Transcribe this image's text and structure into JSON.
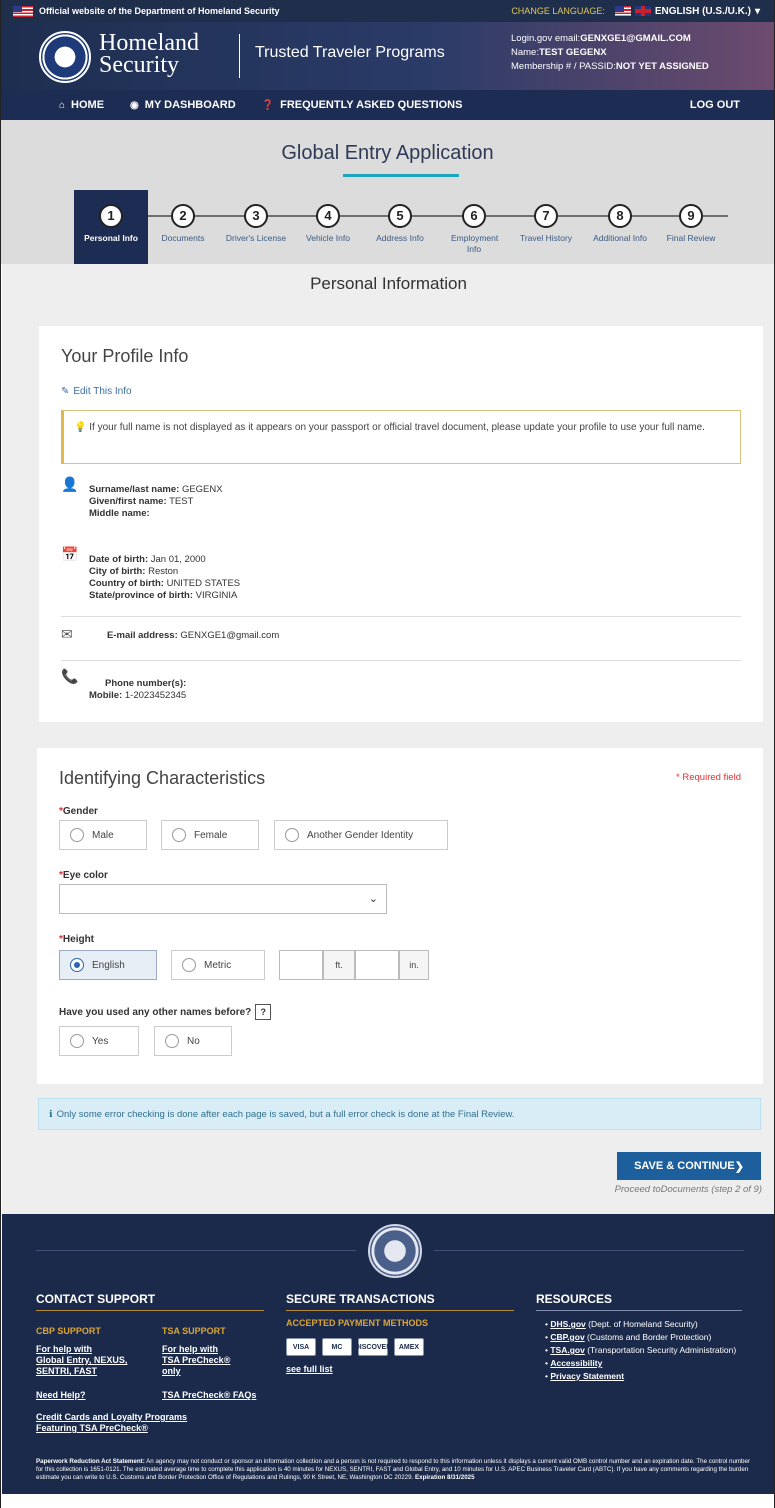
{
  "topbar": {
    "official_text": "Official website of the Department of Homeland Security",
    "change_language_label": "CHANGE LANGUAGE:",
    "language_value": "ENGLISH (U.S./U.K.)"
  },
  "header": {
    "brand_line1": "Homeland",
    "brand_line2": "Security",
    "program_title": "Trusted Traveler Programs",
    "login_label": "Login.gov email:",
    "login_email": "GENXGE1@GMAIL.COM",
    "name_label": "Name:",
    "name_value": "TEST GEGENX",
    "membership_label": "Membership # / PASSID:",
    "membership_value": "NOT YET ASSIGNED"
  },
  "nav": {
    "home": "HOME",
    "dashboard": "MY DASHBOARD",
    "faq": "FREQUENTLY ASKED QUESTIONS",
    "logout": "LOG OUT"
  },
  "page_title": "Global Entry Application",
  "steps": [
    {
      "num": "1",
      "label": "Personal Info",
      "active": true
    },
    {
      "num": "2",
      "label": "Documents"
    },
    {
      "num": "3",
      "label": "Driver's License"
    },
    {
      "num": "4",
      "label": "Vehicle Info"
    },
    {
      "num": "5",
      "label": "Address Info"
    },
    {
      "num": "6",
      "label": "Employment Info"
    },
    {
      "num": "7",
      "label": "Travel History"
    },
    {
      "num": "8",
      "label": "Additional Info"
    },
    {
      "num": "9",
      "label": "Final Review"
    }
  ],
  "section_title": "Personal Information",
  "profile": {
    "heading": "Your Profile Info",
    "edit_link": "Edit This Info",
    "notice": "If your full name is not displayed as it appears on your passport or official travel document, please update your profile to use your full name.",
    "surname_label": "Surname/last name:",
    "surname_value": "GEGENX",
    "given_label": "Given/first name:",
    "given_value": "TEST",
    "middle_label": "Middle name:",
    "middle_value": "",
    "dob_label": "Date of birth:",
    "dob_value": "Jan 01, 2000",
    "city_label": "City of birth:",
    "city_value": "Reston",
    "country_label": "Country of birth:",
    "country_value": "UNITED STATES",
    "state_label": "State/province of birth:",
    "state_value": "VIRGINIA",
    "email_label": "E-mail address:",
    "email_value": "GENXGE1@gmail.com",
    "phone_label": "Phone number(s):",
    "mobile_label": "Mobile:",
    "mobile_value": "1-2023452345"
  },
  "characteristics": {
    "heading": "Identifying Characteristics",
    "required_note": "* Required field",
    "gender_label": "Gender",
    "gender_options": [
      "Male",
      "Female",
      "Another Gender Identity"
    ],
    "eye_label": "Eye color",
    "eye_value": "",
    "height_label": "Height",
    "height_options": [
      "English",
      "Metric"
    ],
    "height_selected": "English",
    "ft_unit": "ft.",
    "in_unit": "in.",
    "other_names_label": "Have you used any other names before?",
    "help_glyph": "?",
    "other_names_options": [
      "Yes",
      "No"
    ]
  },
  "alert_text": "Only some error checking is done after each page is saved, but a full error check is done at the Final Review.",
  "save_button": "SAVE & CONTINUE",
  "proceed_text": "Proceed toDocuments (step 2 of 9)",
  "footer": {
    "contact_heading": "CONTACT SUPPORT",
    "cbp_support": "CBP SUPPORT",
    "tsa_support": "TSA SUPPORT",
    "cbp_link_1": "For help with",
    "cbp_link_2": "Global Entry, NEXUS,",
    "cbp_link_3": "SENTRI, FAST",
    "tsa_link_1": "For help with",
    "tsa_link_2": "TSA PreCheck®",
    "tsa_link_3": "only",
    "need_help": "Need Help?",
    "tsa_faq": "TSA PreCheck® FAQs",
    "credit_1": "Credit Cards and Loyalty Programs",
    "credit_2": "Featuring TSA PreCheck®",
    "secure_heading": "SECURE TRANSACTIONS",
    "payment_heading": "ACCEPTED PAYMENT METHODS",
    "cards": [
      "VISA",
      "MC",
      "DISCOVER",
      "AMEX"
    ],
    "see_full_list": "see full list",
    "resources_heading": "RESOURCES",
    "resources": [
      {
        "link": "DHS.gov",
        "desc": "(Dept. of Homeland Security)"
      },
      {
        "link": "CBP.gov",
        "desc": "(Customs and Border Protection)"
      },
      {
        "link": "TSA.gov",
        "desc": "(Transportation Security Administration)"
      },
      {
        "link": "Accessibility",
        "desc": ""
      },
      {
        "link": "Privacy Statement",
        "desc": ""
      }
    ],
    "pra_label": "Paperwork Reduction Act Statement:",
    "pra_text": "An agency may not conduct or sponsor an information collection and a person is not required to respond to this information unless it displays a current valid OMB control number and an expiration date. The control number for this collection is 1651-0121. The estimated average time to complete this application is 40 minutes for NEXUS, SENTRI, FAST and Global Entry, and 10 minutes for U.S. APEC Business Traveler Card (ABTC). If you have any comments regarding the burden estimate you can write to U.S. Customs and Border Protection Office of Regulations and Rulings, 90 K Street, NE, Washington DC 20229.",
    "expiration": "Expiration 8/31/2025"
  },
  "colors": {
    "navy": "#1d2c53",
    "accent": "#1ea6bf",
    "button": "#1d5f9c",
    "gold": "#d9a53a"
  }
}
